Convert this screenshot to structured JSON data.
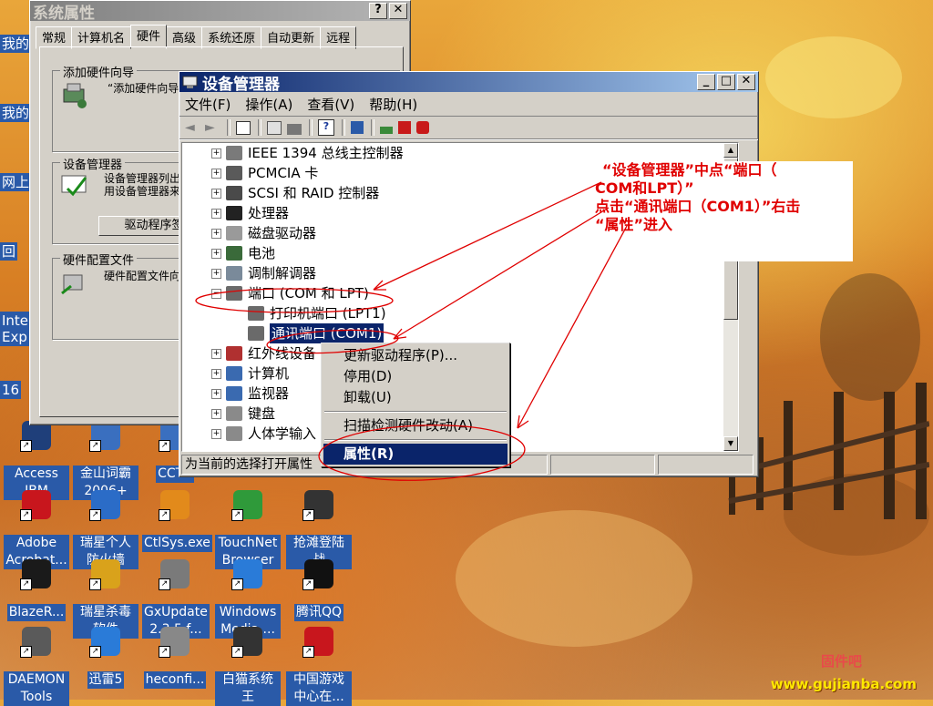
{
  "desktop": {
    "edge_labels": [
      "我的",
      "我的",
      "网上",
      "回",
      "Inte",
      "Exp",
      "16"
    ],
    "icons": [
      {
        "label": "Access IBM",
        "color": "#1f3f7a"
      },
      {
        "label": "金山词霸 2006+",
        "color": "#3a6fbf"
      },
      {
        "label": "CCTV",
        "color": "#3a6fbf"
      },
      {
        "label": "Adobe Acrobat...",
        "color": "#c8161d"
      },
      {
        "label": "瑞星个人防火墙",
        "color": "#2b6cc7"
      },
      {
        "label": "CtlSys.exe",
        "color": "#e28a1b"
      },
      {
        "label": "TouchNet Browser",
        "color": "#2f9a3a"
      },
      {
        "label": "抢滩登陆战",
        "color": "#333333"
      },
      {
        "label": "BlazeR...",
        "color": "#1a1a1a"
      },
      {
        "label": "瑞星杀毒软件",
        "color": "#d9a21b"
      },
      {
        "label": "GxUpdate 2.3.5 f...",
        "color": "#7a7a7a"
      },
      {
        "label": "Windows Media ...",
        "color": "#2a7bd8"
      },
      {
        "label": "腾讯QQ",
        "color": "#111111"
      },
      {
        "label": "DAEMON Tools",
        "color": "#5a5a5a"
      },
      {
        "label": "迅雷5",
        "color": "#2a7bd8"
      },
      {
        "label": "heconfi...",
        "color": "#888888"
      },
      {
        "label": "白猫系统王",
        "color": "#333333"
      },
      {
        "label": "中国游戏中心在...",
        "color": "#c8161d"
      }
    ]
  },
  "sysprops": {
    "title": "系统属性",
    "help_btn": "?",
    "close_btn": "✕",
    "tabs": [
      "常规",
      "计算机名",
      "硬件",
      "高级",
      "系统还原",
      "自动更新",
      "远程"
    ],
    "selected_tab": 2,
    "groups": [
      {
        "title": "添加硬件向导",
        "text": "“添加硬件向导"
      },
      {
        "title": "设备管理器",
        "text": "设备管理器列出\n用设备管理器来"
      },
      {
        "title": "硬件配置文件",
        "text": "硬件配置文件向"
      }
    ],
    "driver_btn": "驱动程序签"
  },
  "devmgr": {
    "title": "设备管理器",
    "min_btn": "_",
    "max_btn": "□",
    "close_btn": "✕",
    "menu": [
      "文件(F)",
      "操作(A)",
      "查看(V)",
      "帮助(H)"
    ],
    "tree": [
      {
        "label": "IEEE 1394 总线主控制器",
        "expander": "+",
        "level": 0,
        "icon": "bus-icon"
      },
      {
        "label": "PCMCIA 卡",
        "expander": "+",
        "level": 0,
        "icon": "pcmcia-icon"
      },
      {
        "label": "SCSI 和 RAID 控制器",
        "expander": "+",
        "level": 0,
        "icon": "scsi-icon"
      },
      {
        "label": "处理器",
        "expander": "+",
        "level": 0,
        "icon": "cpu-icon"
      },
      {
        "label": "磁盘驱动器",
        "expander": "+",
        "level": 0,
        "icon": "disk-icon"
      },
      {
        "label": "电池",
        "expander": "+",
        "level": 0,
        "icon": "battery-icon"
      },
      {
        "label": "调制解调器",
        "expander": "+",
        "level": 0,
        "icon": "modem-icon"
      },
      {
        "label": "端口 (COM 和 LPT)",
        "expander": "−",
        "level": 0,
        "icon": "port-icon"
      },
      {
        "label": "打印机端口 (LPT1)",
        "expander": "",
        "level": 1,
        "icon": "port-icon"
      },
      {
        "label": "通讯端口 (COM1)",
        "expander": "",
        "level": 1,
        "icon": "port-icon",
        "selected": true
      },
      {
        "label": "红外线设备",
        "expander": "+",
        "level": 0,
        "icon": "infrared-icon"
      },
      {
        "label": "计算机",
        "expander": "+",
        "level": 0,
        "icon": "computer-icon"
      },
      {
        "label": "监视器",
        "expander": "+",
        "level": 0,
        "icon": "monitor-icon"
      },
      {
        "label": "键盘",
        "expander": "+",
        "level": 0,
        "icon": "keyboard-icon"
      },
      {
        "label": "人体学输入",
        "expander": "+",
        "level": 0,
        "icon": "hid-icon"
      }
    ],
    "status": "为当前的选择打开属性"
  },
  "context_menu": {
    "items": [
      {
        "label": "更新驱动程序(P)...",
        "name": "update-driver"
      },
      {
        "label": "停用(D)",
        "name": "disable"
      },
      {
        "label": "卸载(U)",
        "name": "uninstall"
      },
      {
        "sep": true
      },
      {
        "label": "扫描检测硬件改动(A)",
        "name": "scan-hardware"
      },
      {
        "sep": true
      },
      {
        "label": "属性(R)",
        "name": "properties",
        "highlight": true
      }
    ]
  },
  "annotation": {
    "line1": "“设备管理器”中点“端口（",
    "line2": "COM和LPT）”",
    "line3": "点击“通讯端口（COM1）”右击",
    "line4": "“属性”进入",
    "color": "#e00000"
  },
  "watermark": {
    "cn": "固件吧",
    "url": "www.gujianba.com"
  }
}
